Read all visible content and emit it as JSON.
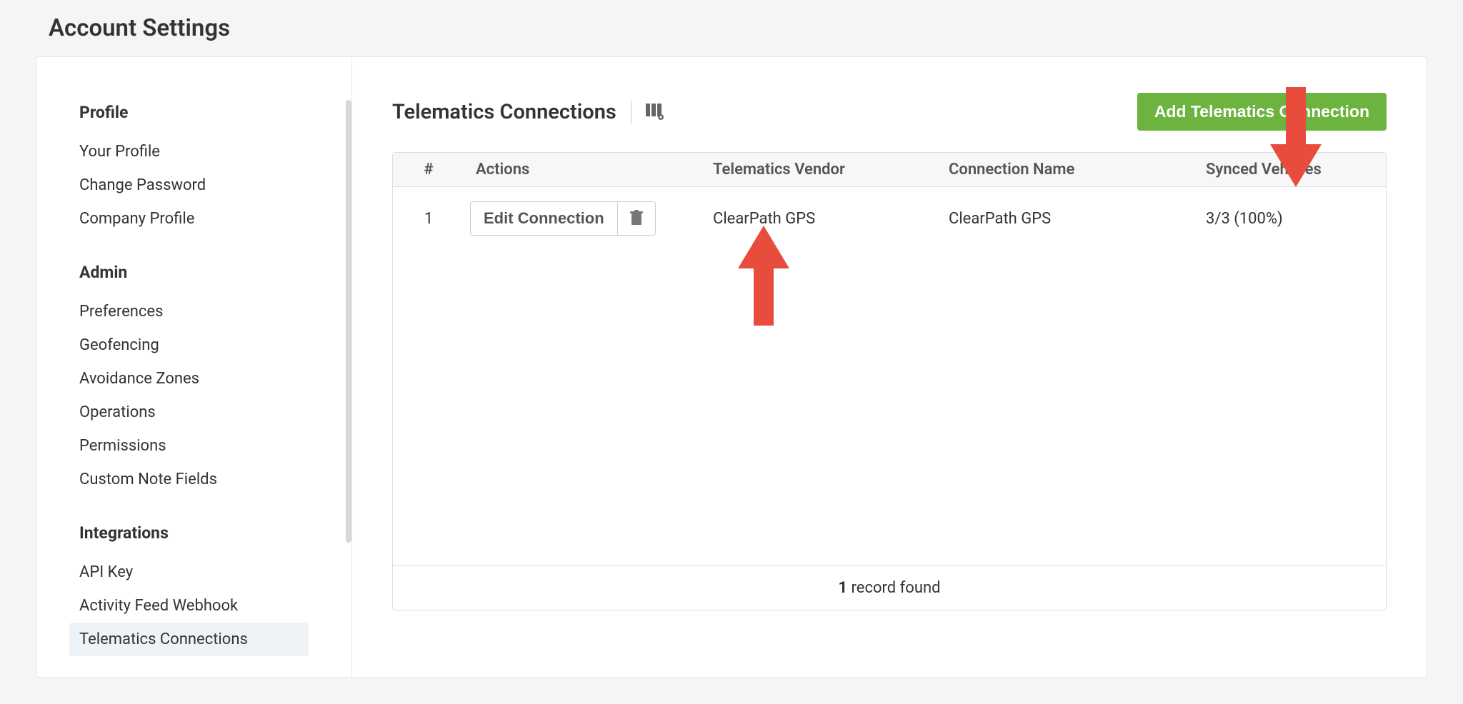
{
  "page_title": "Account Settings",
  "sidebar": {
    "sections": [
      {
        "header": "Profile",
        "items": [
          {
            "label": "Your Profile",
            "active": false
          },
          {
            "label": "Change Password",
            "active": false
          },
          {
            "label": "Company Profile",
            "active": false
          }
        ]
      },
      {
        "header": "Admin",
        "items": [
          {
            "label": "Preferences",
            "active": false
          },
          {
            "label": "Geofencing",
            "active": false
          },
          {
            "label": "Avoidance Zones",
            "active": false
          },
          {
            "label": "Operations",
            "active": false
          },
          {
            "label": "Permissions",
            "active": false
          },
          {
            "label": "Custom Note Fields",
            "active": false
          }
        ]
      },
      {
        "header": "Integrations",
        "items": [
          {
            "label": "API Key",
            "active": false
          },
          {
            "label": "Activity Feed Webhook",
            "active": false
          },
          {
            "label": "Telematics Connections",
            "active": true
          }
        ]
      }
    ]
  },
  "content": {
    "title": "Telematics Connections",
    "add_button_label": "Add Telematics Connection",
    "table": {
      "columns": {
        "num": "#",
        "actions": "Actions",
        "vendor": "Telematics Vendor",
        "name": "Connection Name",
        "synced": "Synced Vehicles"
      },
      "rows": [
        {
          "num": "1",
          "edit_label": "Edit Connection",
          "vendor": "ClearPath GPS",
          "name": "ClearPath GPS",
          "synced": "3/3 (100%)"
        }
      ],
      "footer_count": "1",
      "footer_text": " record found"
    }
  },
  "colors": {
    "accent_green": "#6cb33f",
    "arrow_red": "#e84c3d"
  }
}
